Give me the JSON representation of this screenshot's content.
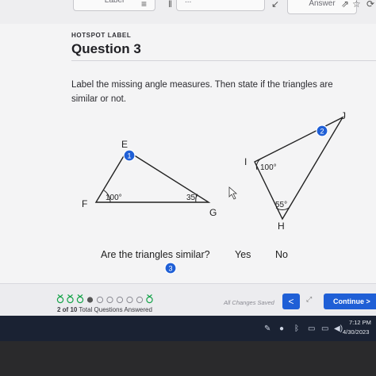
{
  "toolbar": {
    "label_button": "Label",
    "middle_button": "...",
    "answer_button": "Answer"
  },
  "question": {
    "type_label": "HOTSPOT LABEL",
    "title": "Question 3",
    "text": "Label the missing angle measures. Then state if the triangles are similar or not."
  },
  "triangle_fge": {
    "vertex_e": "E",
    "vertex_f": "F",
    "vertex_g": "G",
    "angle_f": "100°",
    "angle_g": "35°",
    "hotspot_number": "1"
  },
  "triangle_ijh": {
    "vertex_i": "I",
    "vertex_j": "J",
    "vertex_h": "H",
    "angle_i": "100°",
    "angle_h": "55°",
    "hotspot_number": "2"
  },
  "similarity": {
    "question": "Are the triangles similar?",
    "yes_label": "Yes",
    "no_label": "No",
    "hotspot_number": "3"
  },
  "footer": {
    "progress_count": "2 of 10",
    "progress_suffix": "Total Questions Answered",
    "saved_status": "All Changes Saved",
    "prev_label": "<",
    "continue_label": "Continue  >",
    "answered_flags": [
      true,
      true,
      true,
      false,
      false,
      false,
      false,
      false,
      false,
      true
    ]
  },
  "taskbar": {
    "time": "7:12 PM",
    "date": "4/30/2023"
  },
  "colors": {
    "accent": "#1f5fd6",
    "success": "#16a34a"
  }
}
